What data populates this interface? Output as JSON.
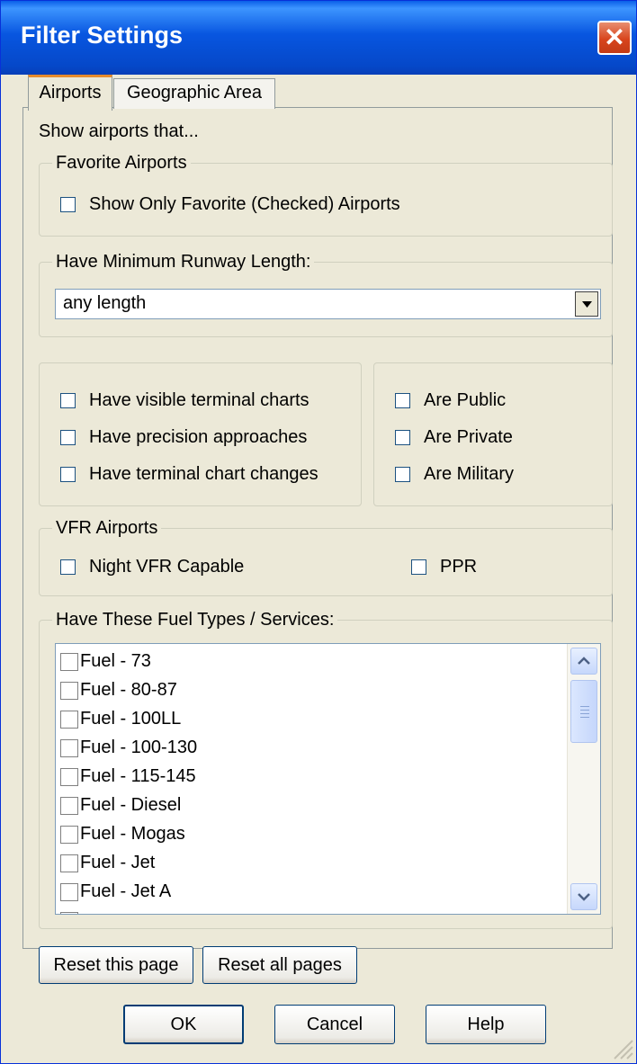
{
  "window": {
    "title": "Filter Settings"
  },
  "tabs": [
    {
      "label": "Airports",
      "active": true
    },
    {
      "label": "Geographic Area",
      "active": false
    }
  ],
  "intro_text": "Show airports that...",
  "favorite_airports": {
    "legend": "Favorite Airports",
    "checkbox_label": "Show Only Favorite (Checked) Airports",
    "checked": false
  },
  "runway": {
    "legend": "Have Minimum Runway Length:",
    "selected_value": "any length"
  },
  "chart_options": [
    {
      "label": "Have visible terminal charts",
      "checked": false
    },
    {
      "label": "Have precision approaches",
      "checked": false
    },
    {
      "label": "Have terminal chart changes",
      "checked": false
    }
  ],
  "type_options": [
    {
      "label": "Are Public",
      "checked": false
    },
    {
      "label": "Are Private",
      "checked": false
    },
    {
      "label": "Are Military",
      "checked": false
    }
  ],
  "vfr": {
    "legend": "VFR Airports",
    "night_label": "Night VFR Capable",
    "ppr_label": "PPR"
  },
  "fuel": {
    "legend": "Have These Fuel Types / Services:",
    "items": [
      "Fuel - 73",
      "Fuel - 80-87",
      "Fuel - 100LL",
      "Fuel - 100-130",
      "Fuel - 115-145",
      "Fuel - Diesel",
      "Fuel - Mogas",
      "Fuel - Jet",
      "Fuel - Jet A"
    ],
    "scroll_position": 0.0
  },
  "buttons": {
    "reset_page": "Reset this page",
    "reset_all": "Reset all pages",
    "ok": "OK",
    "cancel": "Cancel",
    "help": "Help"
  }
}
